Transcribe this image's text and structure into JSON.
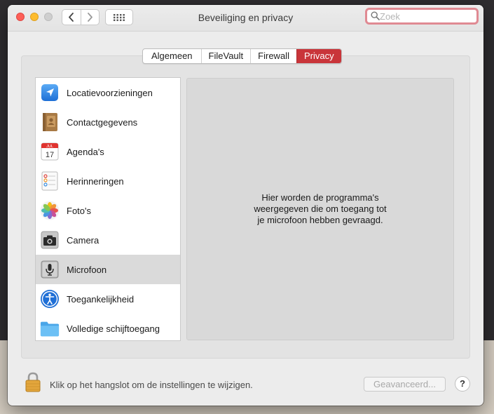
{
  "window": {
    "title": "Beveiliging en privacy"
  },
  "search": {
    "placeholder": "Zoek"
  },
  "tabs": [
    {
      "label": "Algemeen",
      "active": false
    },
    {
      "label": "FileVault",
      "active": false
    },
    {
      "label": "Firewall",
      "active": false
    },
    {
      "label": "Privacy",
      "active": true
    }
  ],
  "privacy_list": [
    {
      "label": "Locatievoorzieningen",
      "icon": "location-arrow-icon"
    },
    {
      "label": "Contactgegevens",
      "icon": "contacts-book-icon"
    },
    {
      "label": "Agenda's",
      "icon": "calendar-icon",
      "calendar_month": "JUL",
      "calendar_day": "17"
    },
    {
      "label": "Herinneringen",
      "icon": "reminders-icon"
    },
    {
      "label": "Foto's",
      "icon": "photos-icon"
    },
    {
      "label": "Camera",
      "icon": "camera-icon"
    },
    {
      "label": "Microfoon",
      "icon": "microphone-icon",
      "selected": true
    },
    {
      "label": "Toegankelijkheid",
      "icon": "accessibility-icon"
    },
    {
      "label": "Volledige schijftoegang",
      "icon": "folder-icon"
    }
  ],
  "detail": {
    "message_lines": [
      "Hier worden de programma's",
      "weergegeven die om toegang tot",
      "je microfoon hebben gevraagd."
    ]
  },
  "footer": {
    "lock_text": "Klik op het hangslot om de instellingen te wijzigen.",
    "advanced_label": "Geavanceerd...",
    "help_label": "?"
  },
  "colors": {
    "active_tab": "#c9353a",
    "search_focus": "#e08a93",
    "selected_row": "#dadada"
  }
}
